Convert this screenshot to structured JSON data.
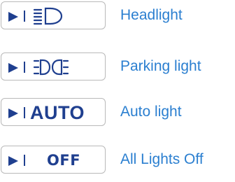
{
  "colors": {
    "label": "#2b7fd0",
    "icon": "#1f3f8f",
    "key_border": "#b9b9b9"
  },
  "rows": [
    {
      "icon": "headlight-icon",
      "key_text": "",
      "label": "Headlight"
    },
    {
      "icon": "parking-light-icon",
      "key_text": "",
      "label": "Parking light"
    },
    {
      "icon": "auto-text",
      "key_text": "AUTO",
      "label": "Auto light"
    },
    {
      "icon": "off-text",
      "key_text": "OFF",
      "label": "All Lights Off"
    }
  ]
}
